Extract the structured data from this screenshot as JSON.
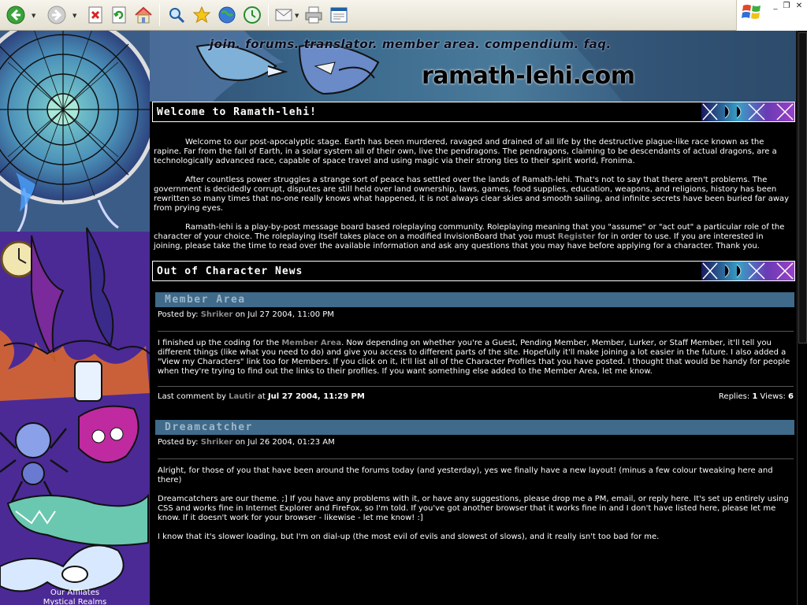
{
  "toolbar": {
    "buttons": [
      "back",
      "forward",
      "stop",
      "refresh",
      "home",
      "search",
      "favorites",
      "media",
      "history",
      "mail",
      "print",
      "edit"
    ]
  },
  "header": {
    "nav": [
      {
        "label": "join."
      },
      {
        "label": "forums."
      },
      {
        "label": "translator."
      },
      {
        "label": "member area."
      },
      {
        "label": "compendium."
      },
      {
        "label": "faq."
      }
    ],
    "site_logo": "ramath-lehi.com"
  },
  "welcome": {
    "title": "Welcome to Ramath-lehi!",
    "p1": "Welcome to our post-apocalyptic stage. Earth has been murdered, ravaged and drained of all life by the destructive plague-like race known as the rapine. Far from the fall of Earth, in a solar system all of their own, live the pendragons. The pendragons, claiming to be descendants of actual dragons, are a technologically advanced race, capable of space travel and using magic via their strong ties to their spirit world, Fronima.",
    "p2": "After countless power struggles a strange sort of peace has settled over the lands of Ramath-lehi. That's not to say that there aren't problems. The government is decidedly corrupt, disputes are still held over land ownership, laws, games, food supplies, education, weapons, and religions, history has been rewritten so many times that no-one really knows what happened, it is not always clear skies and smooth sailing, and infinite secrets have been buried far away from prying eyes.",
    "p3_before": "Ramath-lehi is a play-by-post message board based roleplaying community. Roleplaying meaning that you \"assume\" or \"act out\" a particular role of the character of your choice. The roleplaying itself takes place on a modified InvisionBoard that you must ",
    "p3_link": "Register",
    "p3_after": " for in order to use. If you are interested in joining, please take the time to read over the available information and ask any questions that you may have before applying for a character. Thank you."
  },
  "news": {
    "title": "Out of Character News",
    "items": [
      {
        "title": "Member Area",
        "posted_prefix": "Posted by: ",
        "author": "Shriker",
        "date": " on Jul 27 2004, 11:00 PM",
        "body_before": "I finished up the coding for the ",
        "body_link": "Member Area",
        "body_after": ". Now depending on whether you're a Guest, Pending Member, Member, Lurker, or Staff Member, it'll tell you different things (like what you need to do) and give you access to different parts of the site. Hopefully it'll make joining a lot easier in the future. I also added a \"View my Characters\" link too for Members. If you click on it, it'll list all of the Character Profiles that you have posted. I thought that would be handy for people when they're trying to find out the links to their profiles. If you want something else added to the Member Area, let me know.",
        "last_comment_prefix": "Last comment by ",
        "last_comment_author": "Lautir",
        "last_comment_at": " at ",
        "last_comment_date": "Jul 27 2004, 11:29 PM",
        "replies_label": "Replies: ",
        "replies": "1",
        "views_label": " Views: ",
        "views": "6"
      },
      {
        "title": "Dreamcatcher",
        "posted_prefix": "Posted by: ",
        "author": "Shriker",
        "date": " on Jul 26 2004, 01:23 AM",
        "para1": "Alright, for those of you that have been around the forums today (and yesterday), yes we finally have a new layout! (minus a few colour tweaking here and there)",
        "para2": "Dreamcatchers are our theme. ;] If you have any problems with it, or have any suggestions, please drop me a PM, email, or reply here. It's set up entirely using CSS and works fine in Internet Explorer and FireFox, so I'm told. If you've got another browser that it works fine in and I don't have listed here, please let me know. If it doesn't work for your browser - likewise - let me know! :]",
        "para3": "I know that it's slower loading, but I'm on dial-up (the most evil of evils and slowest of slows), and it really isn't too bad for me."
      }
    ]
  },
  "sidebar": {
    "affiliates_heading": "Our Affilates",
    "affiliate1": "Mystical Realms"
  },
  "colors": {
    "page_bg": "#000000",
    "news_title_bar": "#3f6a8a",
    "news_title_text": "#9fb7c9",
    "link_grey": "#8a8a8a"
  }
}
